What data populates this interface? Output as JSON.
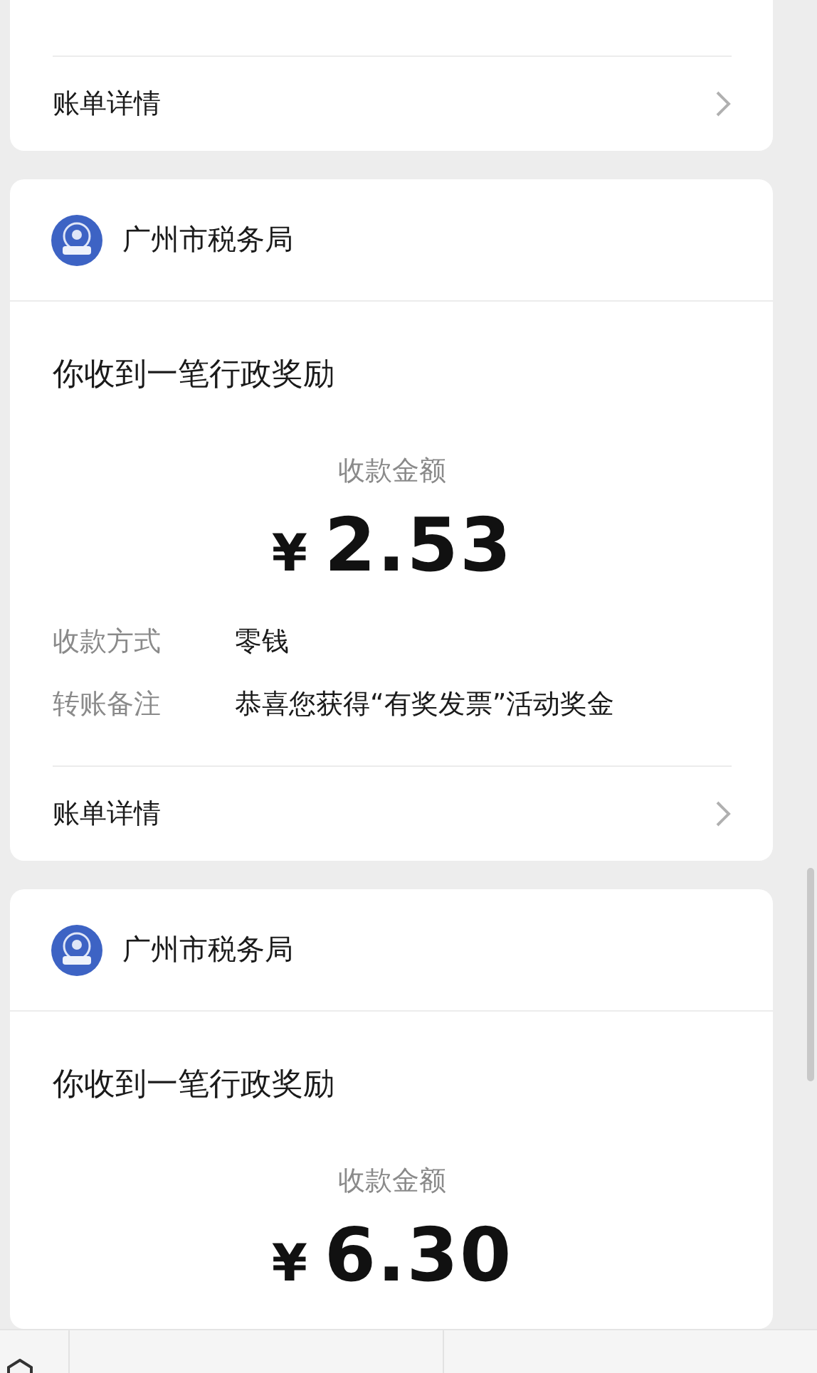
{
  "cards": [
    {
      "kind": "footer_only",
      "footer": "账单详情"
    },
    {
      "kind": "payment",
      "sender": "广州市税务局",
      "title": "你收到一笔行政奖励",
      "amount_label": "收款金额",
      "currency": "¥",
      "amount": "2.53",
      "rows": [
        {
          "label": "收款方式",
          "value": "零钱"
        },
        {
          "label": "转账备注",
          "value": "恭喜您获得“有奖发票”活动奖金"
        }
      ],
      "footer": "账单详情"
    },
    {
      "kind": "payment",
      "sender": "广州市税务局",
      "title": "你收到一笔行政奖励",
      "amount_label": "收款金额",
      "currency": "¥",
      "amount": "6.30"
    }
  ]
}
